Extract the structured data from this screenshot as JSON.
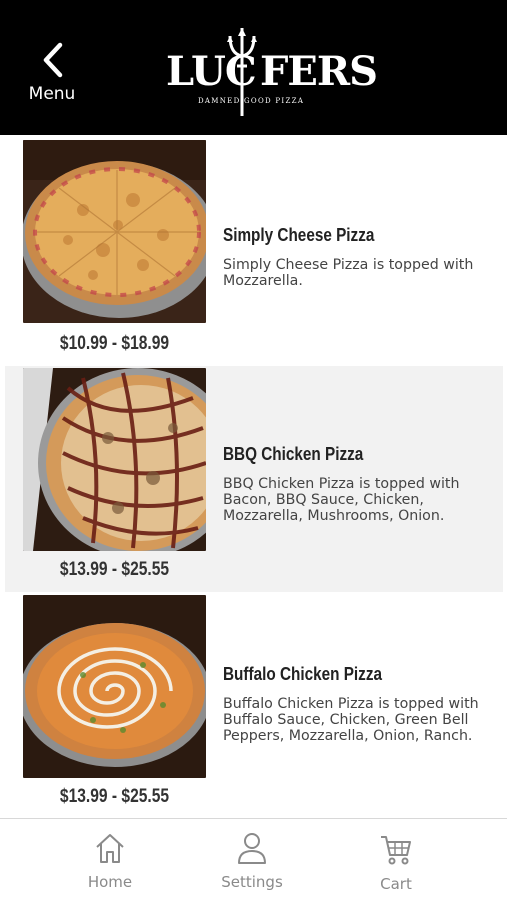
{
  "header": {
    "back_label": "Menu",
    "logo_text_left": "LUC",
    "logo_text_right": "FERS",
    "logo_tagline": "DAMNED GOOD PIZZA"
  },
  "items": [
    {
      "title": "Simply Cheese Pizza",
      "description": "Simply Cheese Pizza is topped with Mozzarella.",
      "price": "$10.99 - $18.99"
    },
    {
      "title": "BBQ Chicken Pizza",
      "description": "BBQ Chicken Pizza is topped with Bacon, BBQ Sauce, Chicken, Mozzarella, Mushrooms, Onion.",
      "price": "$13.99 - $25.55"
    },
    {
      "title": "Buffalo Chicken Pizza",
      "description": "Buffalo Chicken Pizza is topped with Buffalo Sauce, Chicken, Green Bell Peppers, Mozzarella, Onion, Ranch.",
      "price": "$13.99 - $25.55"
    }
  ],
  "tabbar": {
    "home_label": "Home",
    "settings_label": "Settings",
    "cart_label": "Cart"
  },
  "colors": {
    "header_bg": "#000000",
    "shaded_row": "#f2f2f2",
    "tab_icon": "#8a8a8a"
  }
}
